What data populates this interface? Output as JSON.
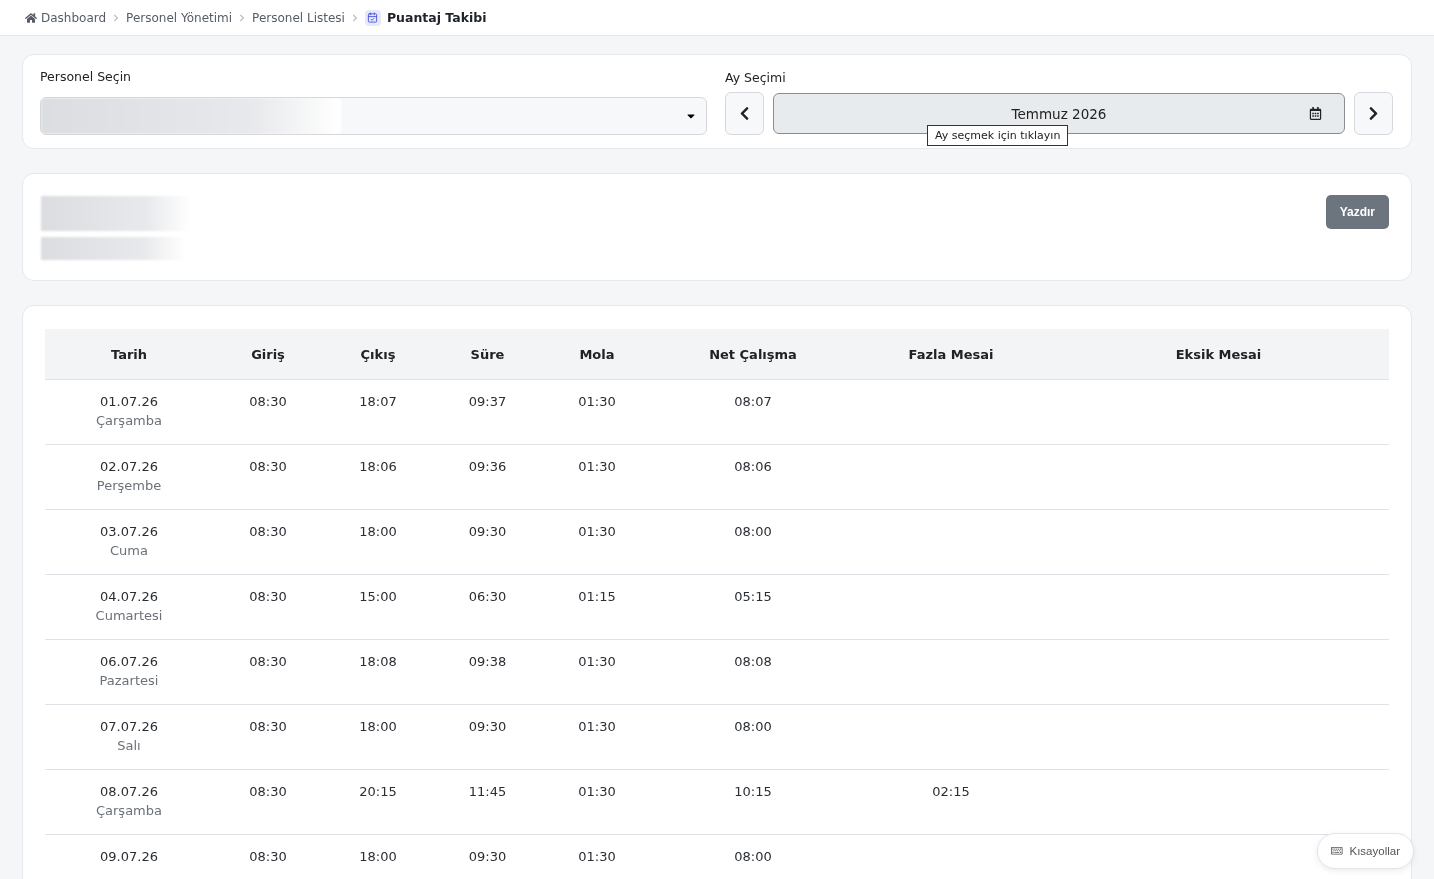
{
  "breadcrumb": [
    {
      "label": "Dashboard",
      "kind": "home"
    },
    {
      "label": "Personel Yönetimi",
      "kind": "link"
    },
    {
      "label": "Personel Listesi",
      "kind": "link"
    },
    {
      "label": "Puantaj Takibi",
      "kind": "current"
    }
  ],
  "filters": {
    "personnel_label": "Personel Seçin",
    "month_label": "Ay Seçimi",
    "month_value": "Temmuz 2026",
    "tooltip": "Ay seçmek için tıklayın"
  },
  "print_button": "Yazdır",
  "table": {
    "columns": [
      "Tarih",
      "Giriş",
      "Çıkış",
      "Süre",
      "Mola",
      "Net Çalışma",
      "Fazla Mesai",
      "Eksik Mesai"
    ],
    "rows": [
      {
        "day": "Çarşamba",
        "cells": [
          "01.07.26",
          "08:30",
          "18:07",
          "09:37",
          "01:30",
          "08:07",
          "",
          ""
        ]
      },
      {
        "day": "Perşembe",
        "cells": [
          "02.07.26",
          "08:30",
          "18:06",
          "09:36",
          "01:30",
          "08:06",
          "",
          ""
        ]
      },
      {
        "day": "Cuma",
        "cells": [
          "03.07.26",
          "08:30",
          "18:00",
          "09:30",
          "01:30",
          "08:00",
          "",
          ""
        ]
      },
      {
        "day": "Cumartesi",
        "cells": [
          "04.07.26",
          "08:30",
          "15:00",
          "06:30",
          "01:15",
          "05:15",
          "",
          ""
        ]
      },
      {
        "day": "Pazartesi",
        "cells": [
          "06.07.26",
          "08:30",
          "18:08",
          "09:38",
          "01:30",
          "08:08",
          "",
          ""
        ]
      },
      {
        "day": "Salı",
        "cells": [
          "07.07.26",
          "08:30",
          "18:00",
          "09:30",
          "01:30",
          "08:00",
          "",
          ""
        ]
      },
      {
        "day": "Çarşamba",
        "cells": [
          "08.07.26",
          "08:30",
          "20:15",
          "11:45",
          "01:30",
          "10:15",
          "02:15",
          ""
        ]
      },
      {
        "cells": [
          "09.07.26",
          "08:30",
          "18:00",
          "09:30",
          "01:30",
          "08:00",
          "",
          ""
        ]
      }
    ]
  },
  "shortcuts_button": "Kısayollar"
}
